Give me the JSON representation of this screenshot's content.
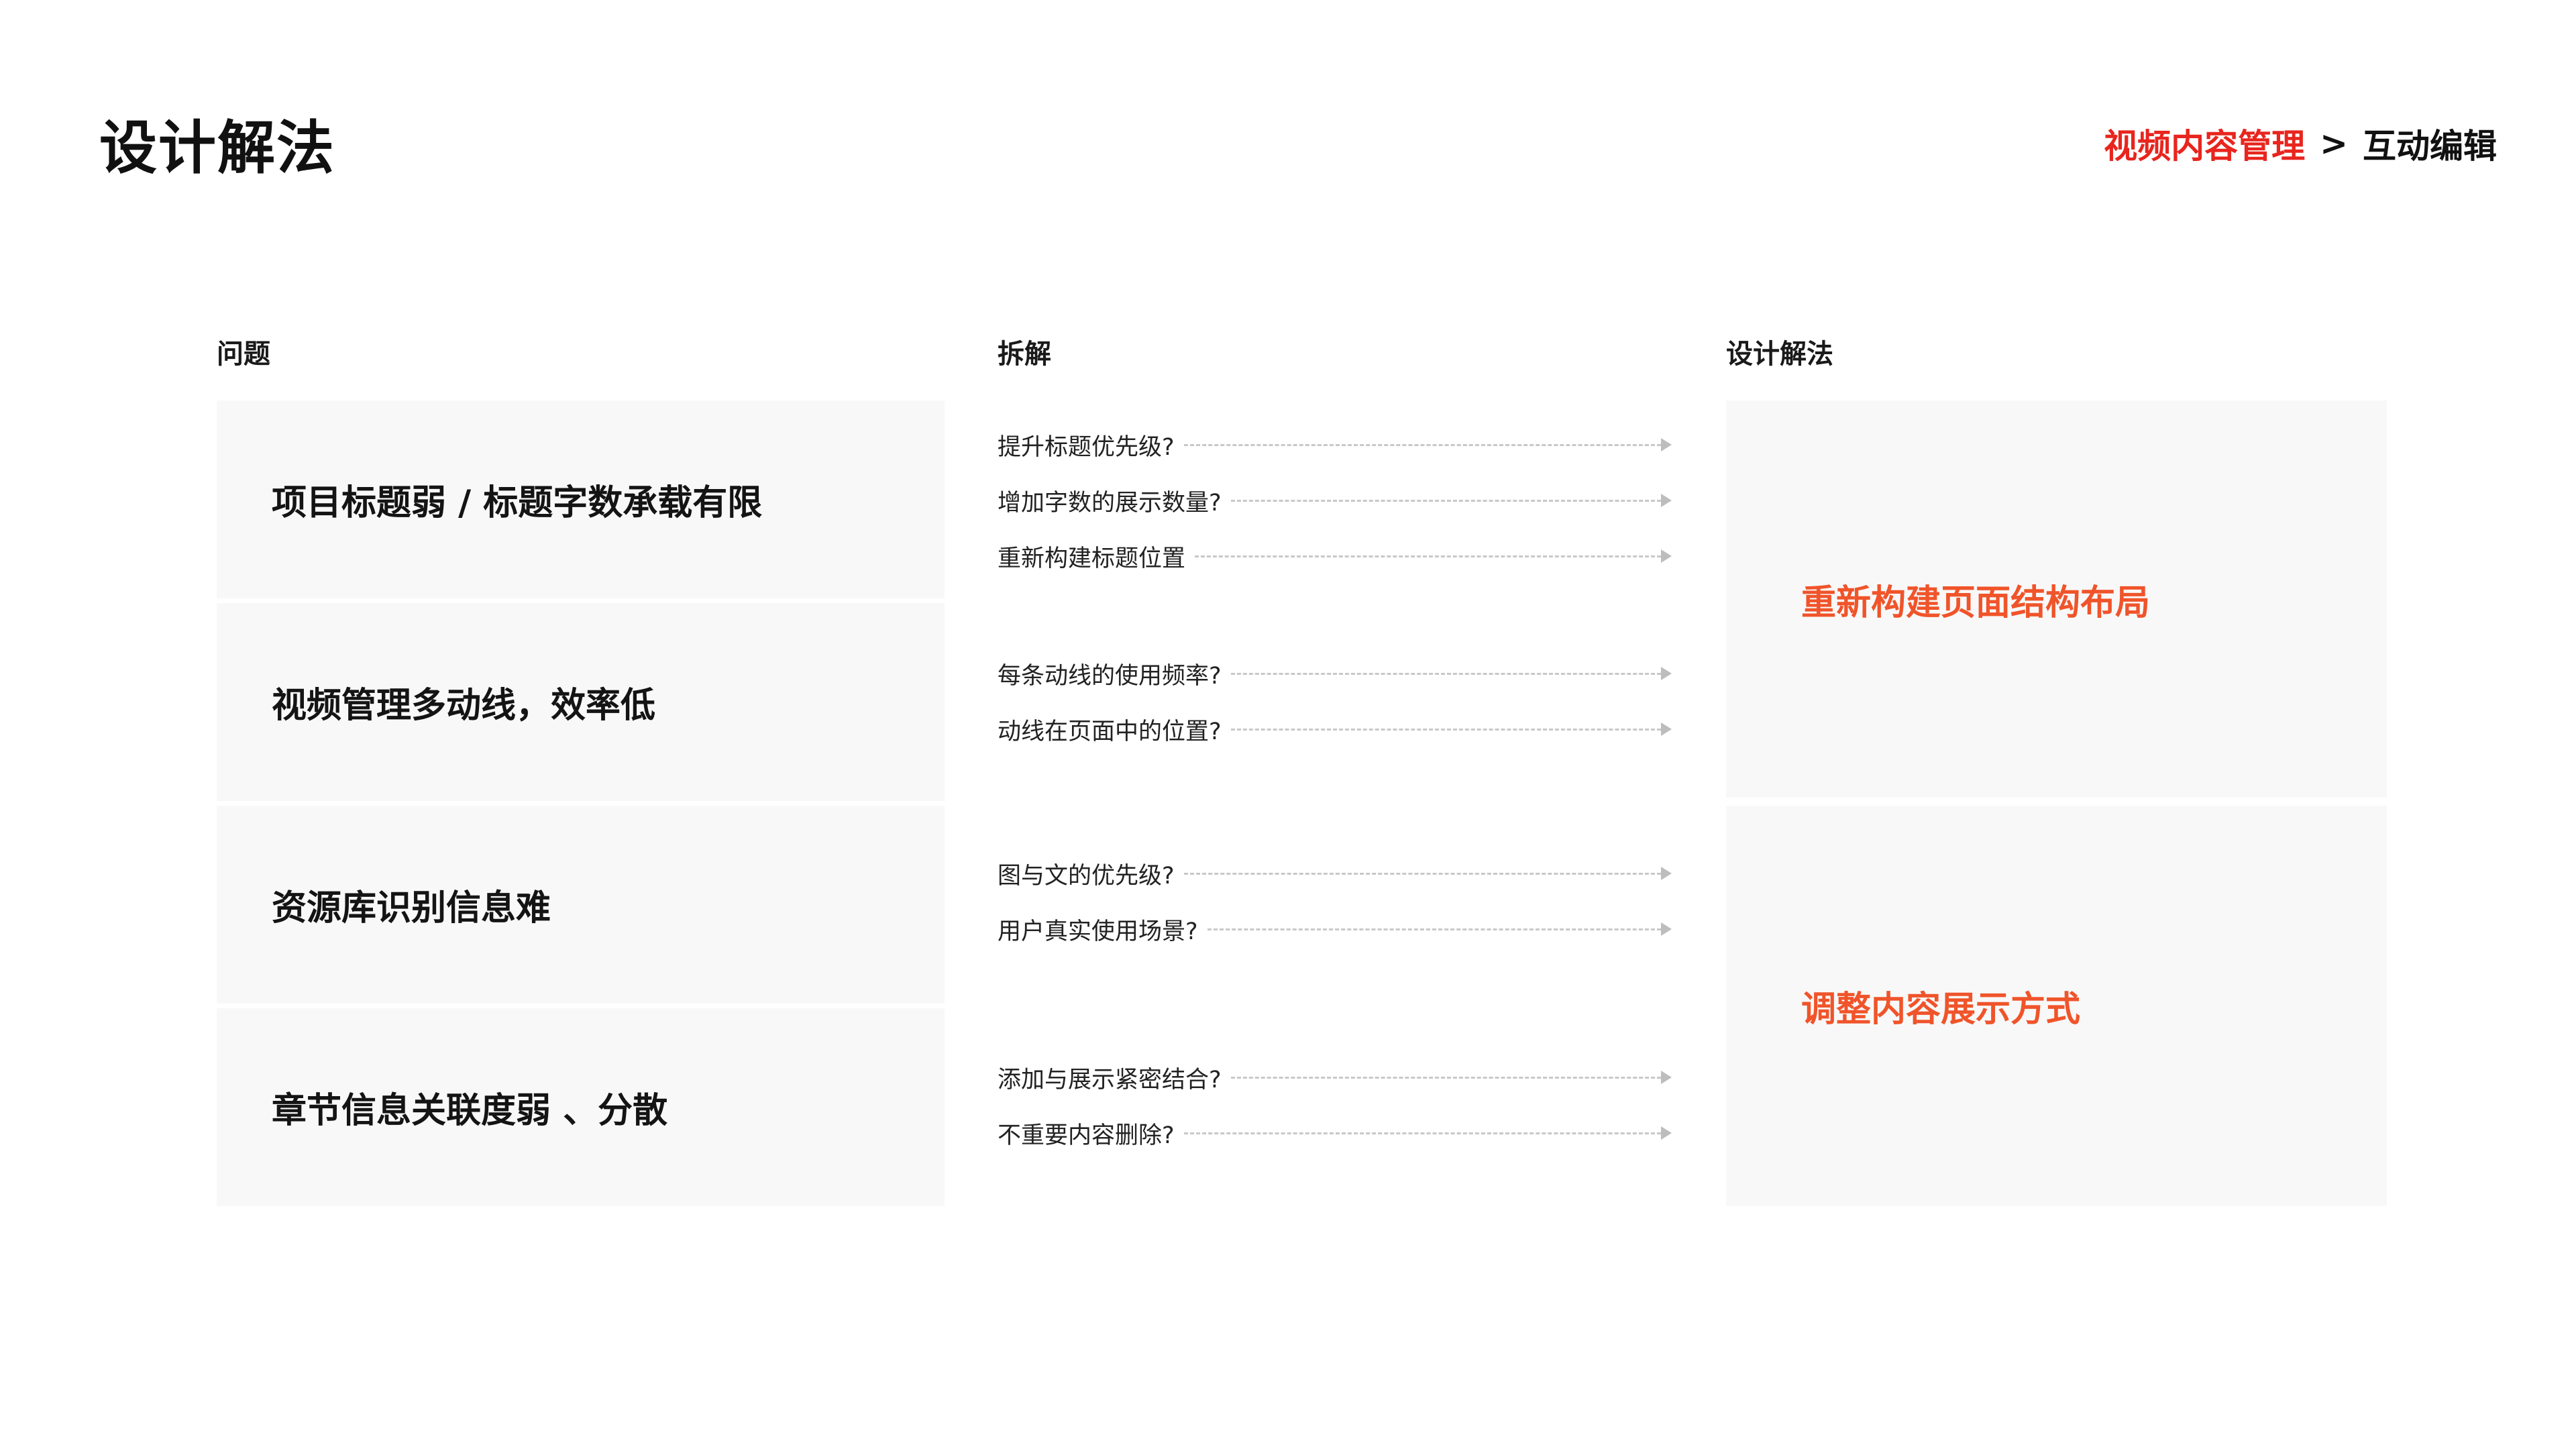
{
  "page": {
    "title": "设计解法"
  },
  "breadcrumb": {
    "active": "视频内容管理",
    "separator": ">",
    "current": "互动编辑"
  },
  "columns": {
    "problem": "问题",
    "breakdown": "拆解",
    "solution": "设计解法"
  },
  "problems": [
    "项目标题弱 / 标题字数承载有限",
    "视频管理多动线，效率低",
    "资源库识别信息难",
    "章节信息关联度弱 、分散"
  ],
  "questions": [
    [
      "提升标题优先级?",
      "增加字数的展示数量?",
      "重新构建标题位置"
    ],
    [
      "每条动线的使用频率?",
      "动线在页面中的位置?"
    ],
    [
      "图与文的优先级?",
      "用户真实使用场景?"
    ],
    [
      "添加与展示紧密结合?",
      "不重要内容删除?"
    ]
  ],
  "solutions": [
    "重新构建页面结构布局",
    "调整内容展示方式"
  ],
  "colors": {
    "accent_red": "#e8251e",
    "solution_orange": "#f0542a",
    "card_bg": "#f8f8f8"
  }
}
